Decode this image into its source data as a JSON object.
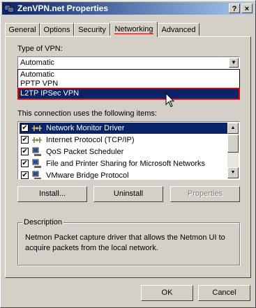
{
  "window": {
    "title": "ZenVPN.net Properties",
    "help_button": "?",
    "close_button": "×"
  },
  "tabs": [
    {
      "label": "General"
    },
    {
      "label": "Options"
    },
    {
      "label": "Security"
    },
    {
      "label": "Networking",
      "active": true
    },
    {
      "label": "Advanced"
    }
  ],
  "vpn_type": {
    "label": "Type of VPN:",
    "selected": "Automatic",
    "options": [
      "Automatic",
      "PPTP VPN",
      "L2TP IPSec VPN"
    ],
    "highlighted": "L2TP IPSec VPN"
  },
  "items": {
    "label": "This connection uses the following items:",
    "rows": [
      {
        "text": "Network Monitor Driver",
        "checked": true,
        "selected": true,
        "icon": "network-protocol-icon"
      },
      {
        "text": "Internet Protocol (TCP/IP)",
        "checked": true,
        "selected": false,
        "icon": "network-protocol-icon"
      },
      {
        "text": "QoS Packet Scheduler",
        "checked": true,
        "selected": false,
        "icon": "network-service-icon"
      },
      {
        "text": "File and Printer Sharing for Microsoft Networks",
        "checked": true,
        "selected": false,
        "icon": "network-service-icon"
      },
      {
        "text": "VMware Bridge Protocol",
        "checked": true,
        "selected": false,
        "icon": "network-service-icon"
      }
    ]
  },
  "buttons": {
    "install": "Install...",
    "uninstall": "Uninstall",
    "properties": "Properties",
    "ok": "OK",
    "cancel": "Cancel"
  },
  "description": {
    "legend": "Description",
    "text": "Netmon Packet capture driver that allows the Netmon UI to acquire packets from the local network."
  },
  "colors": {
    "selection": "#0a246a",
    "highlight_outline": "#e00000",
    "face": "#d4d0c8"
  }
}
